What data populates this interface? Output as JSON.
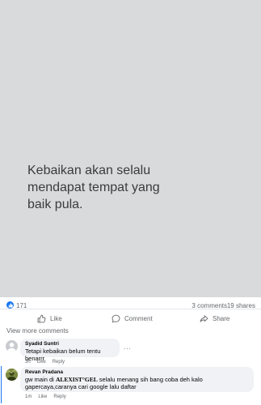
{
  "post": {
    "image_text": "Kebaikan akan selalu\nmendapat tempat yang\nbaik pula."
  },
  "stats": {
    "like_count": "171",
    "comments": "3 comments",
    "shares": "19 shares"
  },
  "actions": {
    "like": "Like",
    "comment": "Comment",
    "share": "Share"
  },
  "view_more": "View more comments",
  "comments": [
    {
      "author": "Syadid Suntri",
      "text": "Tetapi kebaikan belum tentu benarrr",
      "time": "3h",
      "like": "Like",
      "reply": "Reply",
      "more": "..."
    },
    {
      "author": "Revan Pradana",
      "text_before": "gw main di ",
      "brand": "ALEXIST°GEL",
      "text_after": " selalu menang sih bang coba deh kalo gapercaya,caranya cari google lalu daftar",
      "time": "1m",
      "like": "Like",
      "reply": "Reply"
    }
  ],
  "colors": {
    "accent": "#1877f2",
    "image_bg": "#d9dadc",
    "muted_text": "#65676b",
    "bubble": "#f0f2f5"
  }
}
